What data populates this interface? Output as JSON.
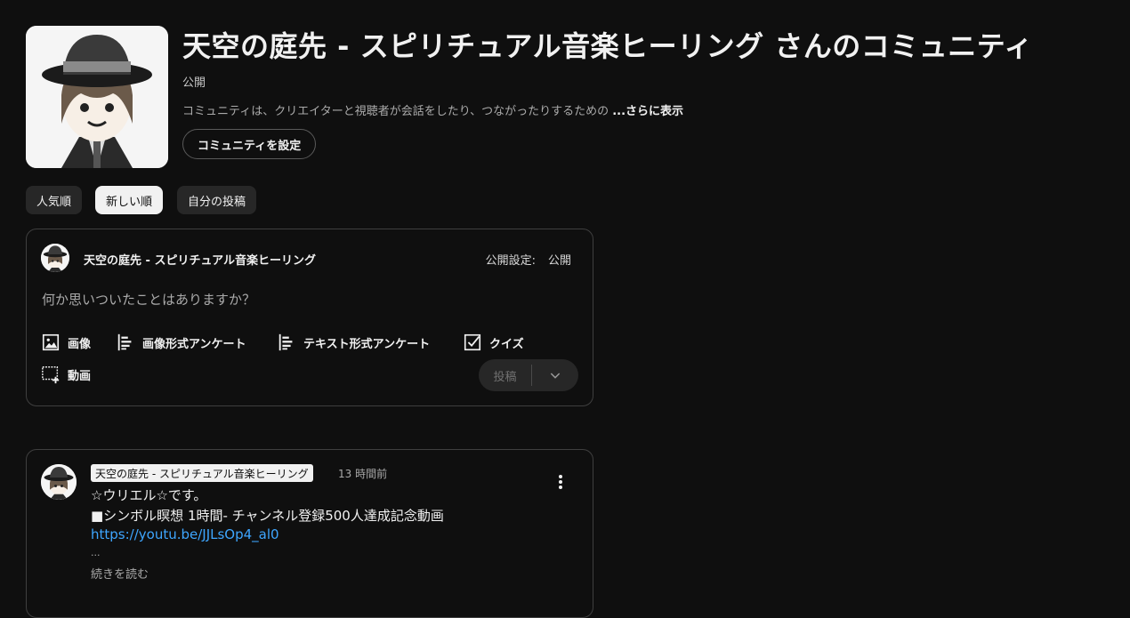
{
  "header": {
    "title": "天空の庭先 - スピリチュアル音楽ヒーリング さんのコミュニティ",
    "visibility": "公開",
    "description": "コミュニティは、クリエイターと視聴者が会話をしたり、つながったりするための",
    "more_label": "...さらに表示",
    "setup_button": "コミュニティを設定"
  },
  "filters": [
    {
      "label": "人気順",
      "active": false
    },
    {
      "label": "新しい順",
      "active": true
    },
    {
      "label": "自分の投稿",
      "active": false
    }
  ],
  "composer": {
    "channel_name": "天空の庭先 - スピリチュアル音楽ヒーリング",
    "visibility_label": "公開設定:",
    "visibility_value": "公開",
    "prompt": "何か思いついたことはありますか？",
    "tools": [
      {
        "label": "画像",
        "icon": "image-icon"
      },
      {
        "label": "画像形式アンケート",
        "icon": "image-poll-icon"
      },
      {
        "label": "テキスト形式アンケート",
        "icon": "text-poll-icon"
      },
      {
        "label": "クイズ",
        "icon": "quiz-icon"
      },
      {
        "label": "動画",
        "icon": "video-add-icon"
      }
    ],
    "post_button": "投稿"
  },
  "post": {
    "author": "天空の庭先 - スピリチュアル音楽ヒーリング",
    "time": "13 時間前",
    "lines": [
      "☆ウリエル☆です。",
      "■シンボル瞑想 1時間- チャンネル登録500人達成記念動画"
    ],
    "link": "https://youtu.be/JJLsOp4_al0",
    "ellipsis": "...",
    "read_more": "続きを読む"
  },
  "colors": {
    "background": "#0f0f0f",
    "chip_active": "#f1f1f1",
    "link": "#3ea6ff"
  }
}
